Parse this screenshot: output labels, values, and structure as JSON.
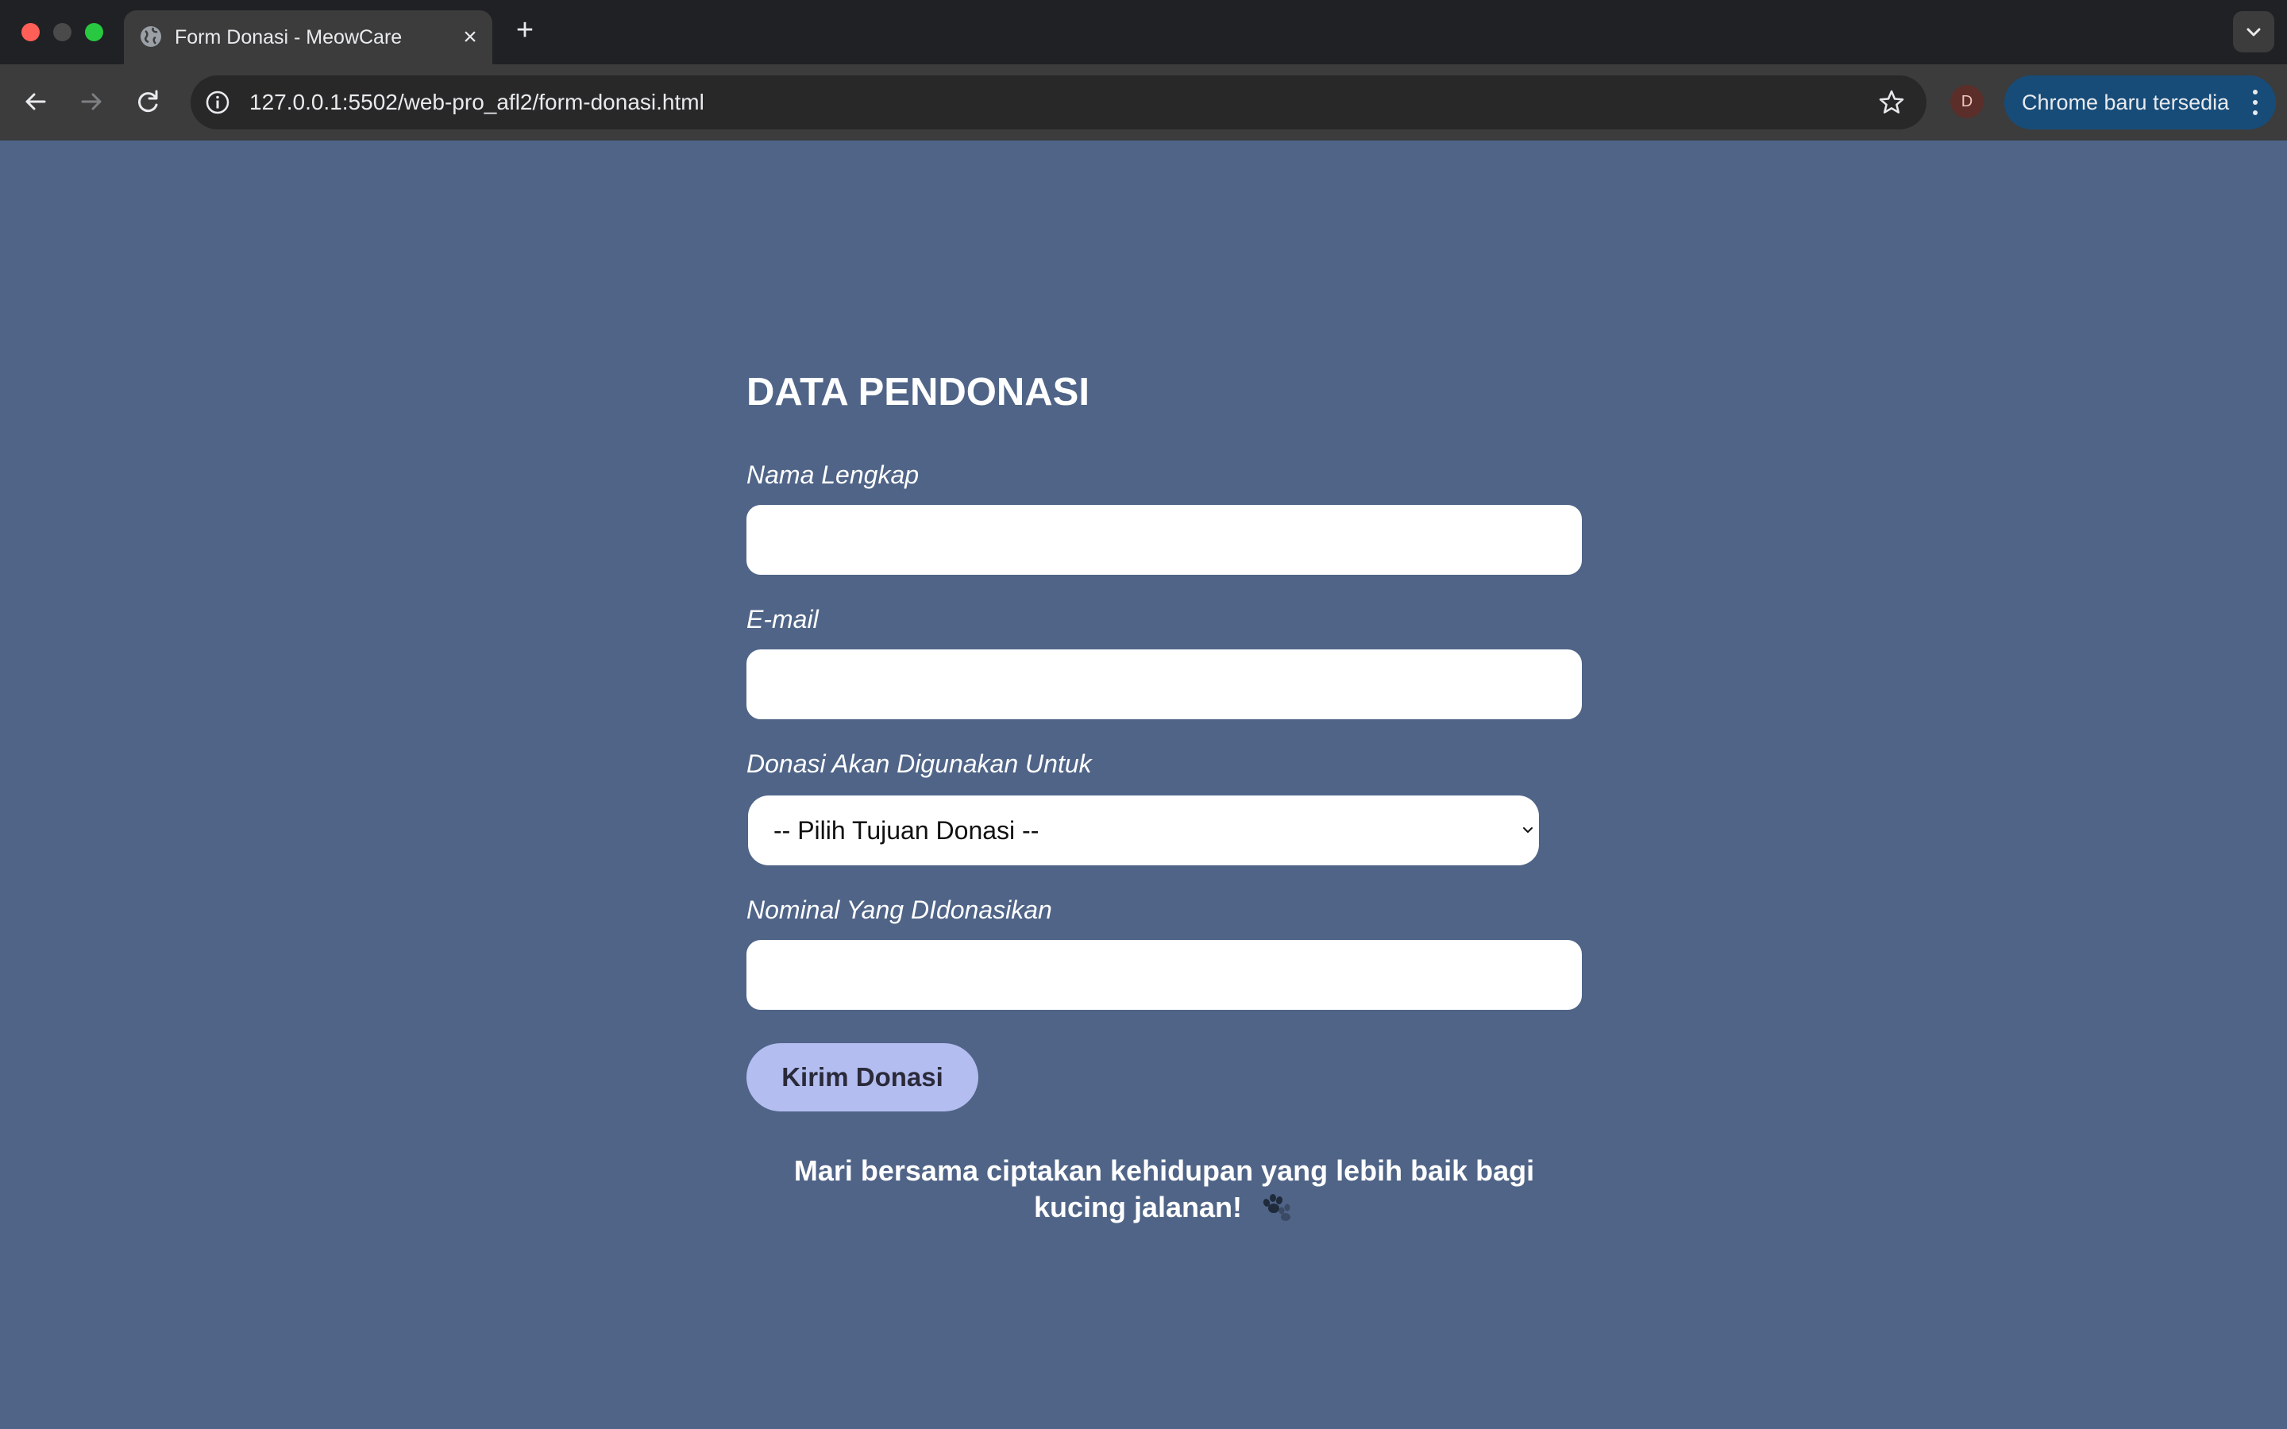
{
  "browser": {
    "tab": {
      "title": "Form Donasi - MeowCare",
      "icon": "globe-icon"
    },
    "new_tab_label": "+",
    "url": "127.0.0.1:5502/web-pro_afl2/form-donasi.html",
    "profile_initial": "D",
    "update_label": "Chrome baru tersedia"
  },
  "form": {
    "title": "DATA PENDONASI",
    "fields": [
      {
        "label": "Nama Lengkap",
        "value": ""
      },
      {
        "label": "E-mail",
        "value": ""
      },
      {
        "label": "Donasi Akan Digunakan Untuk",
        "value": "-- Pilih Tujuan Donasi --"
      },
      {
        "label": "Nominal Yang DIdonasikan",
        "value": ""
      }
    ],
    "submit_label": "Kirim Donasi"
  },
  "footer": {
    "tagline": "Mari bersama ciptakan kehidupan yang lebih baik bagi kucing jalanan!",
    "icon": "paw-icon"
  },
  "colors": {
    "page_background": "#4f6487",
    "button": "#b3bdf0",
    "chrome_dark": "#202124",
    "toolbar": "#3c3c3c",
    "update_button": "#174c79"
  }
}
